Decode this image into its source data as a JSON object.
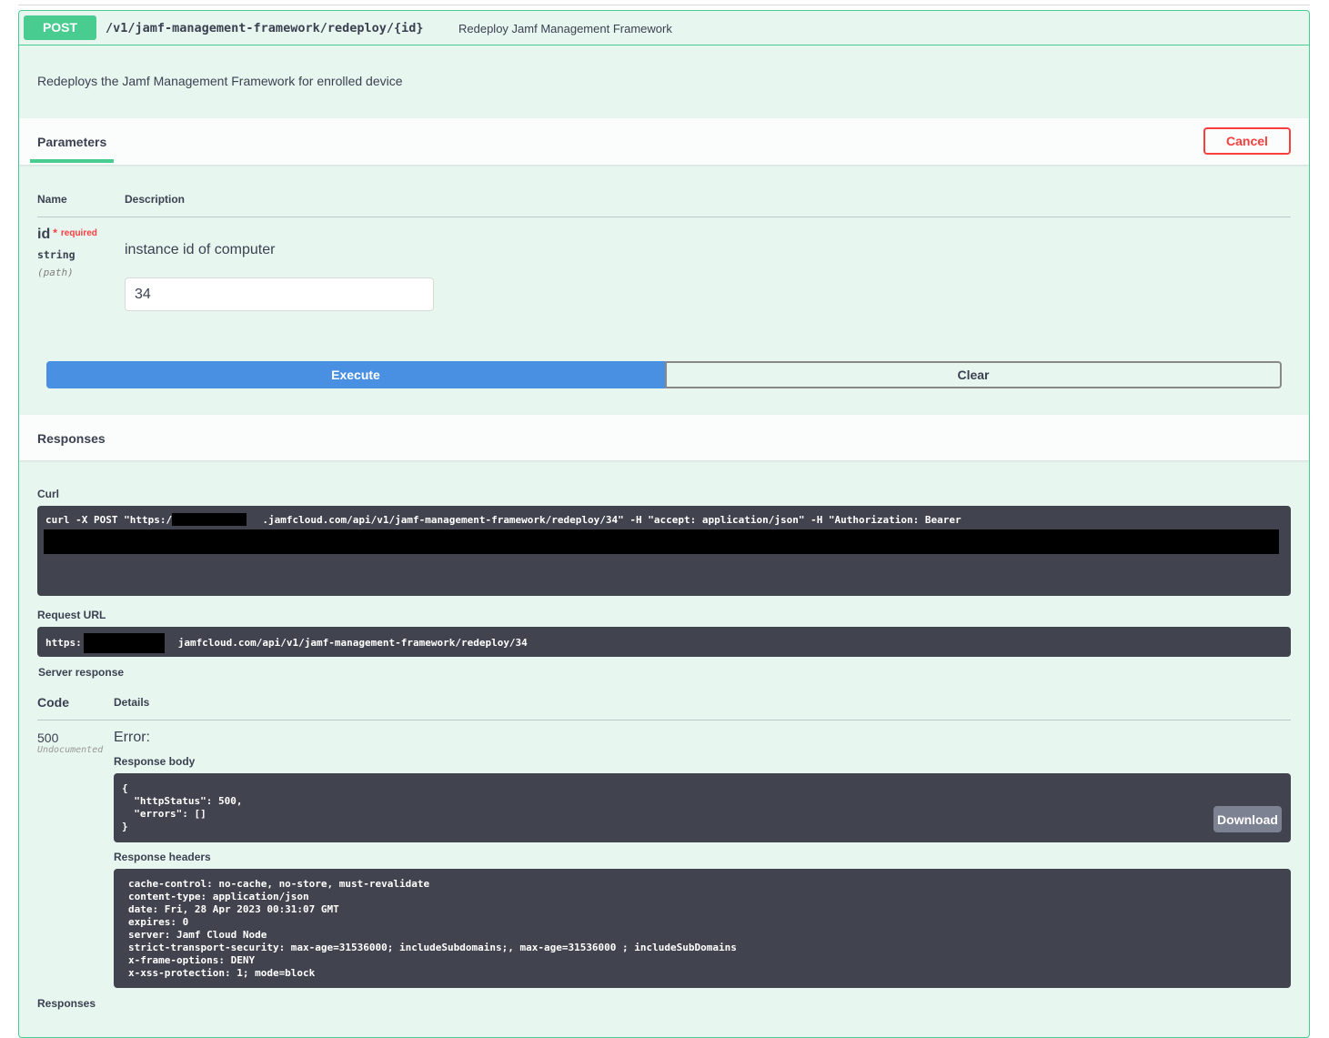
{
  "operation": {
    "method": "POST",
    "path": "/v1/jamf-management-framework/redeploy/{id}",
    "summary": "Redeploy Jamf Management Framework",
    "description": "Redeploys the Jamf Management Framework for enrolled device"
  },
  "parameters_section": {
    "tab_label": "Parameters",
    "cancel_label": "Cancel",
    "col_name": "Name",
    "col_description": "Description",
    "param": {
      "name": "id",
      "required_star": "*",
      "required_label": "required",
      "type": "string",
      "in": "(path)",
      "description": "instance id of computer",
      "value": "34"
    },
    "execute_label": "Execute",
    "clear_label": "Clear"
  },
  "responses_section": {
    "title": "Responses",
    "curl_label": "Curl",
    "curl_text": "curl -X POST \"https:/               .jamfcloud.com/api/v1/jamf-management-framework/redeploy/34\" -H \"accept: application/json\" -H \"Authorization: Bearer",
    "request_url_label": "Request URL",
    "request_url": "https:                jamfcloud.com/api/v1/jamf-management-framework/redeploy/34",
    "server_response_label": "Server response",
    "code_header": "Code",
    "details_header": "Details",
    "status_code": "500",
    "status_note": "Undocumented",
    "error_label": "Error:",
    "response_body_label": "Response body",
    "response_body": "{\n  \"httpStatus\": 500,\n  \"errors\": []\n}",
    "download_label": "Download",
    "response_headers_label": "Response headers",
    "response_headers": "cache-control: no-cache, no-store, must-revalidate\ncontent-type: application/json\ndate: Fri, 28 Apr 2023 00:31:07 GMT\nexpires: 0\nserver: Jamf Cloud Node\nstrict-transport-security: max-age=31536000; includeSubdomains;, max-age=31536000 ; includeSubDomains\nx-frame-options: DENY\nx-xss-protection: 1; mode=block",
    "responses_footer": "Responses"
  },
  "colors": {
    "post_green": "#49cc90",
    "block_background": "#e8f6f0",
    "execute_blue": "#4990e2",
    "cancel_red": "#f93e3e",
    "code_background": "#41444e"
  }
}
